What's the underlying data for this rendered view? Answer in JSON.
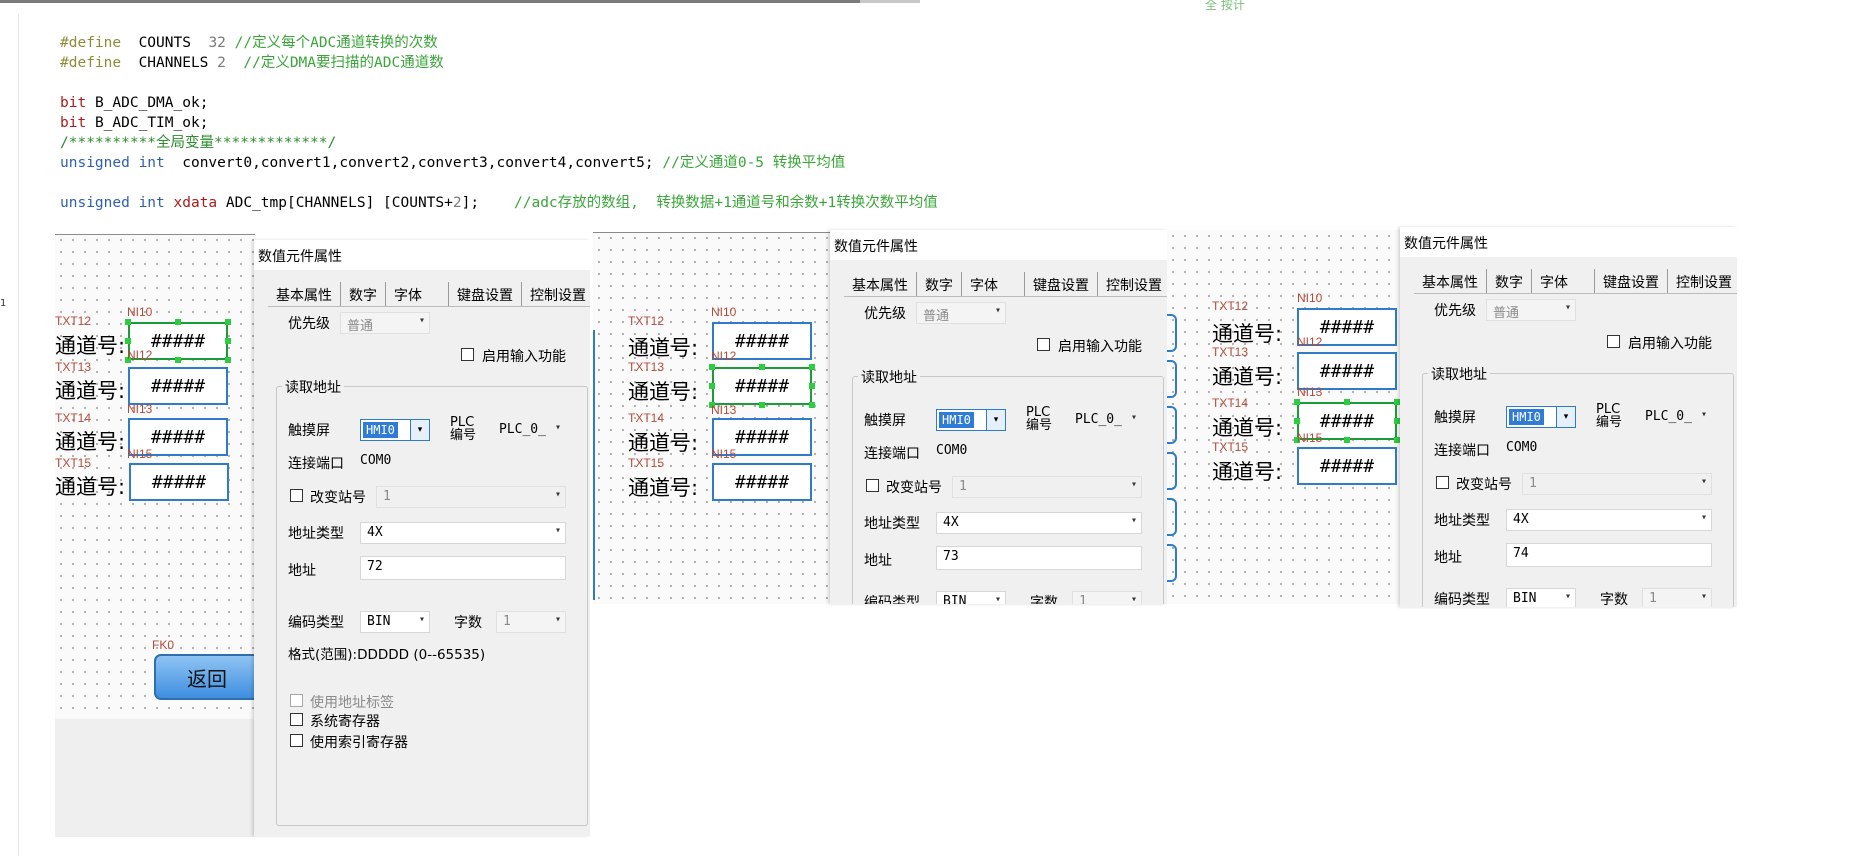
{
  "top_fragment": "全     按计",
  "left_fragment": "1",
  "code": {
    "line1": {
      "kw": "#define",
      "name": "COUNTS",
      "val": "32",
      "comment": "//定义每个ADC通道转换的次数"
    },
    "line2": {
      "kw": "#define",
      "name": "CHANNELS",
      "val": "2",
      "comment": "//定义DMA要扫描的ADC通道数"
    },
    "line3": {
      "kw": "bit",
      "rest": "B_ADC_DMA_ok;"
    },
    "line4": {
      "kw": "bit",
      "rest": "B_ADC_TIM_ok;"
    },
    "line5": {
      "text": "/**********全局变量*************/"
    },
    "line6": {
      "kw": "unsigned int",
      "rest": "convert0,convert1,convert2,convert3,convert4,convert5;",
      "comment": "//定义通道0-5 转换平均值"
    },
    "line7": {
      "kw": "unsigned int",
      "kw2": "xdata",
      "rest_a": "ADC_tmp[CHANNELS] [COUNTS+",
      "num": "2",
      "rest_b": "];",
      "comment": "//adc存放的数组,  转换数据+1通道号和余数+1转换次数平均值"
    }
  },
  "canvas": {
    "rows": [
      {
        "txt": "TXT12",
        "ni": "NI10",
        "label": "通道号:"
      },
      {
        "txt": "TXT13",
        "ni": "NI12",
        "label": "通道号:"
      },
      {
        "txt": "TXT14",
        "ni": "NI13",
        "label": "通道号:"
      },
      {
        "txt": "TXT15",
        "ni": "NI15",
        "label": "通道号:"
      }
    ],
    "value_mask": "#####",
    "fk_label": "FK0",
    "return_button": "返回"
  },
  "dialog": {
    "title": "数值元件属性",
    "tabs": [
      "基本属性",
      "数字",
      "字体",
      "键盘设置",
      "控制设置"
    ],
    "priority_label": "优先级",
    "priority_value": "普通",
    "enable_input_label": "启用输入功能",
    "read_group_label": "读取地址",
    "touch_label": "触摸屏",
    "touch_value": "HMI0",
    "plc_label_1": "PLC",
    "plc_label_2": "编号",
    "plc_value": "PLC_0_",
    "port_label": "连接端口",
    "port_value": "COM0",
    "change_station_label": "改变站号",
    "station_value": "1",
    "addr_type_label": "地址类型",
    "addr_type_value": "4X",
    "addr_label": "地址",
    "encode_label": "编码类型",
    "encode_value": "BIN",
    "words_label": "字数",
    "words_value": "1",
    "format_text": "格式(范围):DDDDD (0--65535)",
    "use_addr_tag": "使用地址标签",
    "sys_register": "系统寄存器",
    "index_register": "使用索引寄存器"
  },
  "addresses": [
    "72",
    "73",
    "74"
  ]
}
